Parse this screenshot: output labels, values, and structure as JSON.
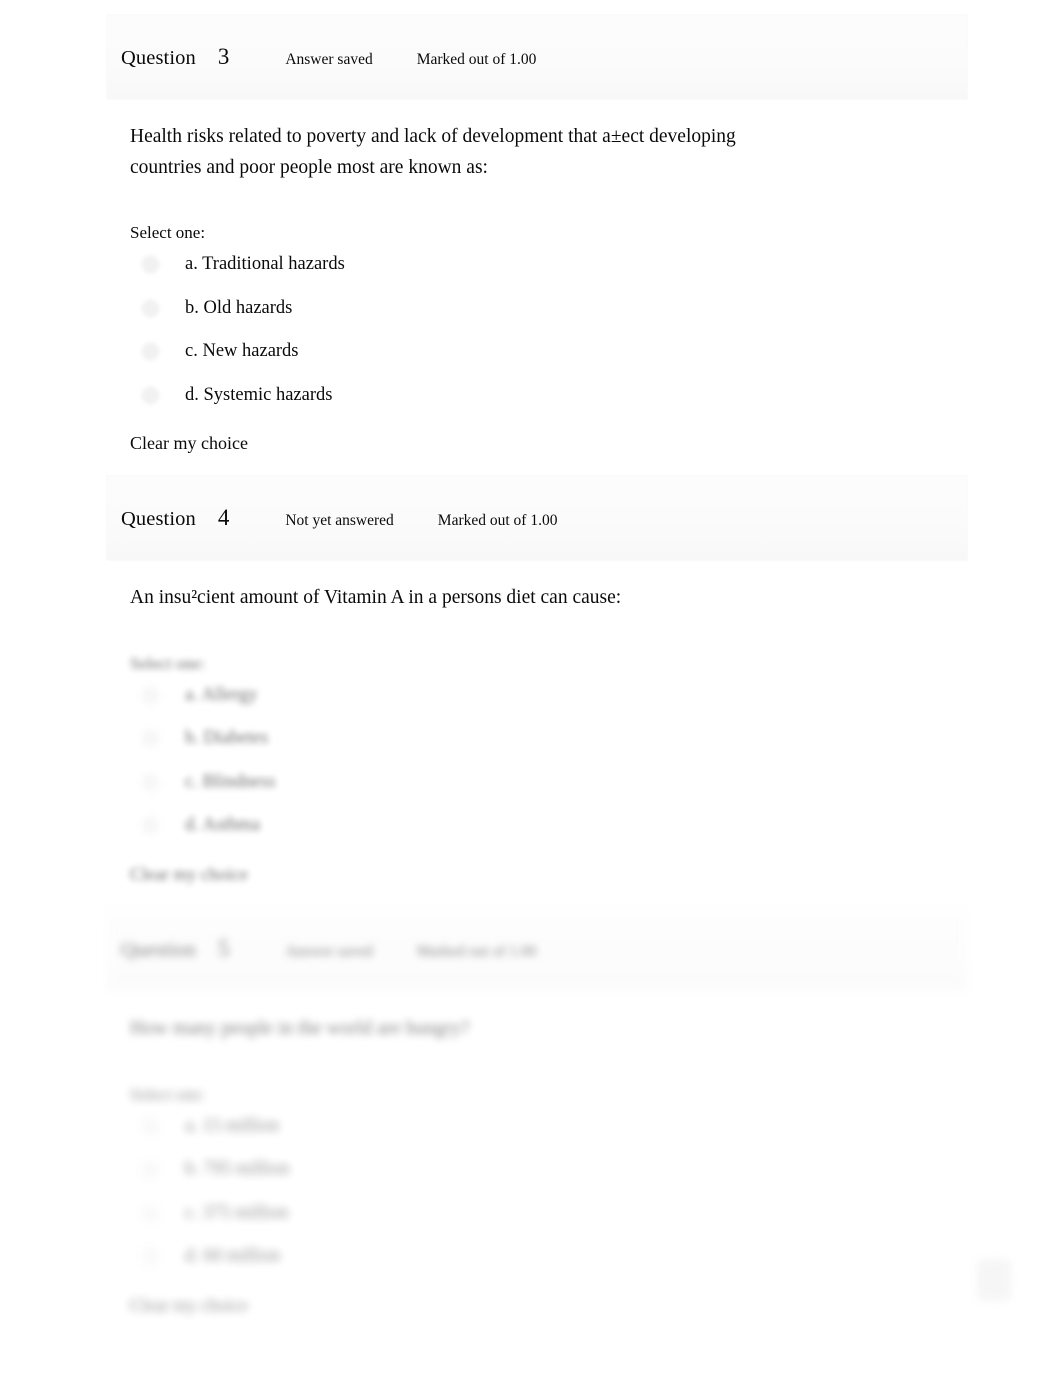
{
  "page": {
    "background": "#ffffff",
    "text_color": "#0a0a0a"
  },
  "questions": [
    {
      "label": "Question",
      "number": "3",
      "state": "Answer saved",
      "mark": "Marked out of 1.00",
      "text": "Health risks related to poverty and lack of development that a±ect developing countries and poor people most are known as:",
      "select_prompt": "Select one:",
      "options": [
        {
          "key": "a.",
          "label": "a. Traditional hazards"
        },
        {
          "key": "b.",
          "label": "b. Old hazards"
        },
        {
          "key": "c.",
          "label": "c. New hazards"
        },
        {
          "key": "d.",
          "label": "d. Systemic hazards"
        }
      ],
      "clear_choice": "Clear my choice"
    },
    {
      "label": "Question",
      "number": "4",
      "state": "Not yet answered",
      "mark": "Marked out of 1.00",
      "text": "An insu²cient amount of Vitamin A in a persons diet can cause:",
      "select_prompt": "Select one:",
      "options": [
        {
          "key": "a.",
          "label": "a. Allergy"
        },
        {
          "key": "b.",
          "label": "b. Diabetes"
        },
        {
          "key": "c.",
          "label": "c. Blindness"
        },
        {
          "key": "d.",
          "label": "d. Asthma"
        }
      ],
      "clear_choice": "Clear my choice"
    },
    {
      "label": "Question",
      "number": "5",
      "state": "Answer saved",
      "mark": "Marked out of 1.00",
      "text": "How many people in the world are hungry?",
      "select_prompt": "Select one:",
      "options": [
        {
          "key": "a.",
          "label": "a. 15 million"
        },
        {
          "key": "b.",
          "label": "b. 795 million"
        },
        {
          "key": "c.",
          "label": "c. 375 million"
        },
        {
          "key": "d.",
          "label": "d. 60 million"
        }
      ],
      "clear_choice": "Clear my choice"
    }
  ],
  "corner_button": {
    "icon": "scroll-to-top-icon"
  }
}
